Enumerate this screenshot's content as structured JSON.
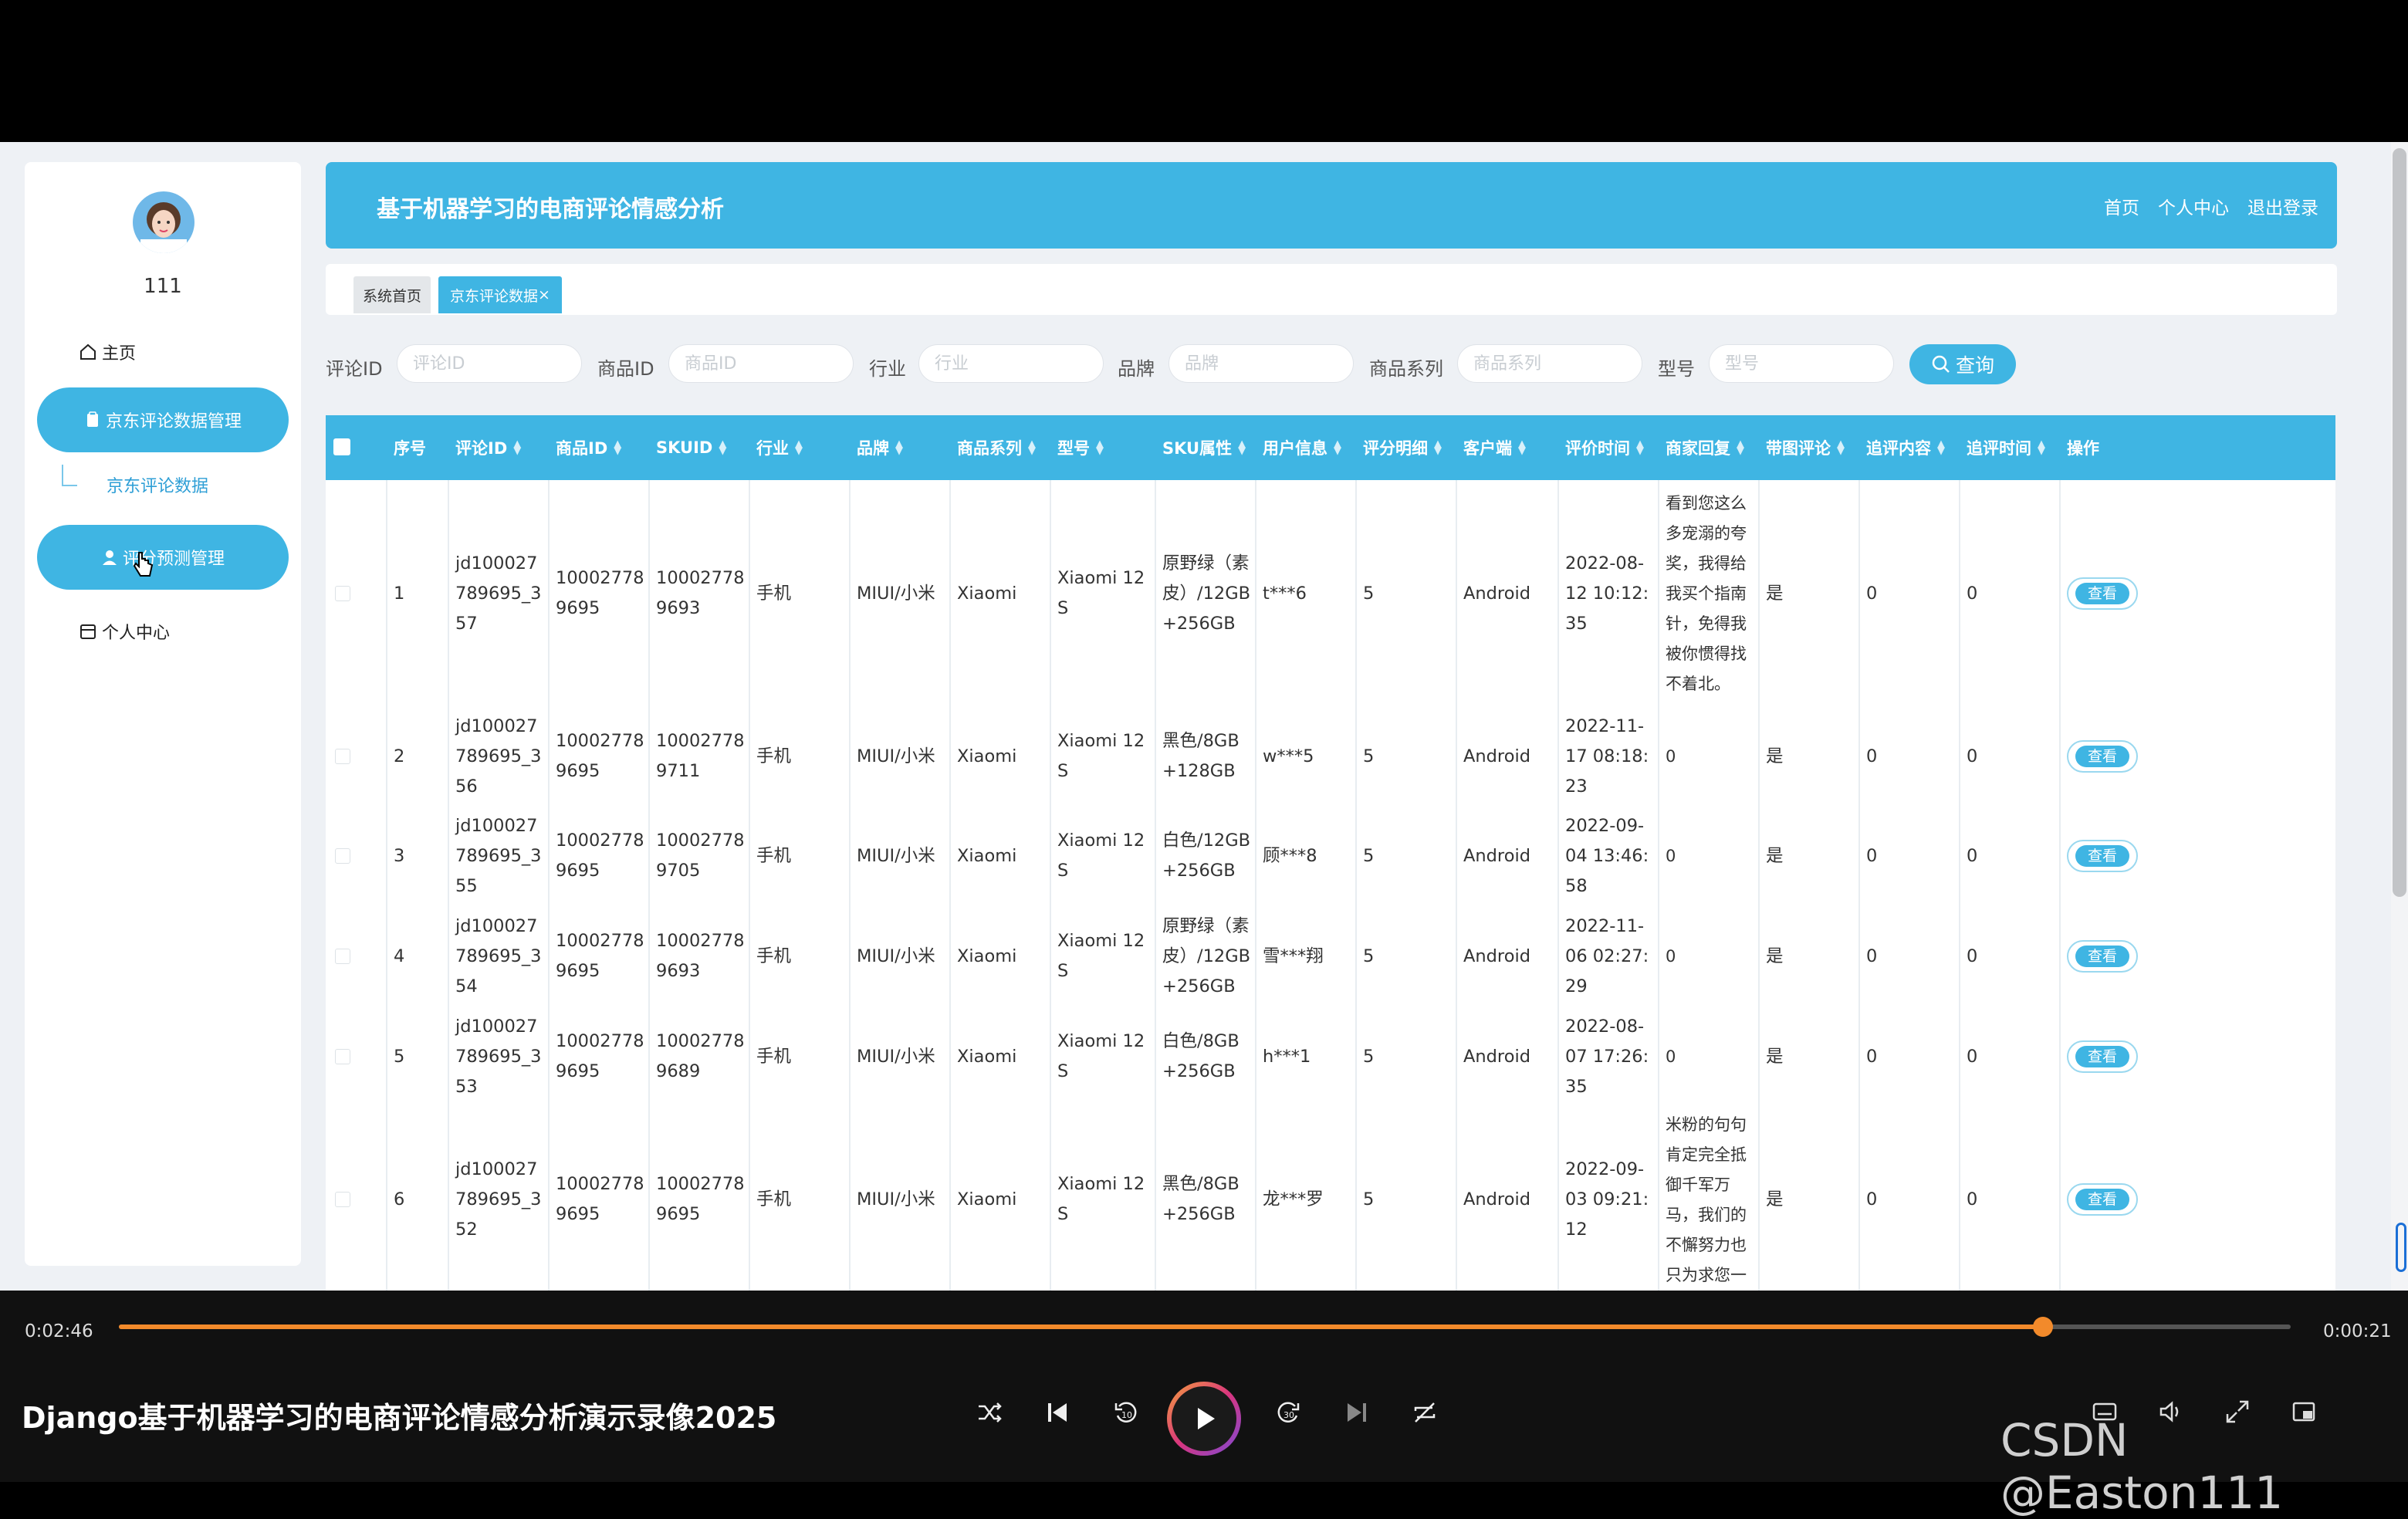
{
  "sidebar": {
    "username": "111",
    "home_label": "主页",
    "jd_menu_label": "京东评论数据管理",
    "jd_sub_label": "京东评论数据",
    "score_menu_label": "评分预测管理",
    "profile_label": "个人中心"
  },
  "header": {
    "title": "基于机器学习的电商评论情感分析",
    "links": [
      "首页",
      "个人中心",
      "退出登录"
    ]
  },
  "tabs": {
    "home": "系统首页",
    "active": "京东评论数据",
    "close": "×"
  },
  "search": {
    "fields": [
      {
        "label": "评论ID",
        "placeholder": "评论ID"
      },
      {
        "label": "商品ID",
        "placeholder": "商品ID"
      },
      {
        "label": "行业",
        "placeholder": "行业"
      },
      {
        "label": "品牌",
        "placeholder": "品牌"
      },
      {
        "label": "商品系列",
        "placeholder": "商品系列"
      },
      {
        "label": "型号",
        "placeholder": "型号"
      }
    ],
    "button": "查询"
  },
  "table": {
    "headers": [
      "序号",
      "评论ID",
      "商品ID",
      "SKUID",
      "行业",
      "品牌",
      "商品系列",
      "型号",
      "SKU属性",
      "用户信息",
      "评分明细",
      "客户端",
      "评价时间",
      "商家回复",
      "带图评论",
      "追评内容",
      "追评时间",
      "操作"
    ],
    "rows": [
      {
        "no": "1",
        "cid": "jd100027789695_357",
        "pid": "100027789695",
        "sku": "100027789693",
        "ind": "手机",
        "brand": "MIUI/小米",
        "series": "Xiaomi",
        "model": "Xiaomi 12S",
        "attr": "原野绿（素皮）/12GB+256GB",
        "user": "t***6",
        "score": "5",
        "client": "Android",
        "time": "2022-08-12 10:12:35",
        "reply": "看到您这么多宠溺的夸奖，我得给我买个指南针，免得我被你惯得找不着北。",
        "img": "是",
        "add": "0",
        "addtime": "0",
        "op": "查看"
      },
      {
        "no": "2",
        "cid": "jd100027789695_356",
        "pid": "100027789695",
        "sku": "100027789711",
        "ind": "手机",
        "brand": "MIUI/小米",
        "series": "Xiaomi",
        "model": "Xiaomi 12S",
        "attr": "黑色/8GB+128GB",
        "user": "w***5",
        "score": "5",
        "client": "Android",
        "time": "2022-11-17 08:18:23",
        "reply": "0",
        "img": "是",
        "add": "0",
        "addtime": "0",
        "op": "查看"
      },
      {
        "no": "3",
        "cid": "jd100027789695_355",
        "pid": "100027789695",
        "sku": "100027789705",
        "ind": "手机",
        "brand": "MIUI/小米",
        "series": "Xiaomi",
        "model": "Xiaomi 12S",
        "attr": "白色/12GB+256GB",
        "user": "顾***8",
        "score": "5",
        "client": "Android",
        "time": "2022-09-04 13:46:58",
        "reply": "0",
        "img": "是",
        "add": "0",
        "addtime": "0",
        "op": "查看"
      },
      {
        "no": "4",
        "cid": "jd100027789695_354",
        "pid": "100027789695",
        "sku": "100027789693",
        "ind": "手机",
        "brand": "MIUI/小米",
        "series": "Xiaomi",
        "model": "Xiaomi 12S",
        "attr": "原野绿（素皮）/12GB+256GB",
        "user": "雪***翔",
        "score": "5",
        "client": "Android",
        "time": "2022-11-06 02:27:29",
        "reply": "0",
        "img": "是",
        "add": "0",
        "addtime": "0",
        "op": "查看"
      },
      {
        "no": "5",
        "cid": "jd100027789695_353",
        "pid": "100027789695",
        "sku": "100027789689",
        "ind": "手机",
        "brand": "MIUI/小米",
        "series": "Xiaomi",
        "model": "Xiaomi 12S",
        "attr": "白色/8GB+256GB",
        "user": "h***1",
        "score": "5",
        "client": "Android",
        "time": "2022-08-07 17:26:35",
        "reply": "0",
        "img": "是",
        "add": "0",
        "addtime": "0",
        "op": "查看"
      },
      {
        "no": "6",
        "cid": "jd100027789695_352",
        "pid": "100027789695",
        "sku": "100027789695",
        "ind": "手机",
        "brand": "MIUI/小米",
        "series": "Xiaomi",
        "model": "Xiaomi 12S",
        "attr": "黑色/8GB+256GB",
        "user": "龙***罗",
        "score": "5",
        "client": "Android",
        "time": "2022-09-03 09:21:12",
        "reply": "米粉的句句肯定完全抵御千军万马，我们的不懈努力也只为求您一",
        "img": "是",
        "add": "0",
        "addtime": "0",
        "op": "查看"
      }
    ]
  },
  "player": {
    "elapsed": "0:02:46",
    "remaining": "0:00:21",
    "progress": 0.886,
    "title": "Django基于机器学习的电商评论情感分析演示录像2025",
    "watermark": "CSDN @Easton111",
    "accent": "#f28a2b"
  },
  "colors": {
    "primary": "#3fb5e3"
  }
}
